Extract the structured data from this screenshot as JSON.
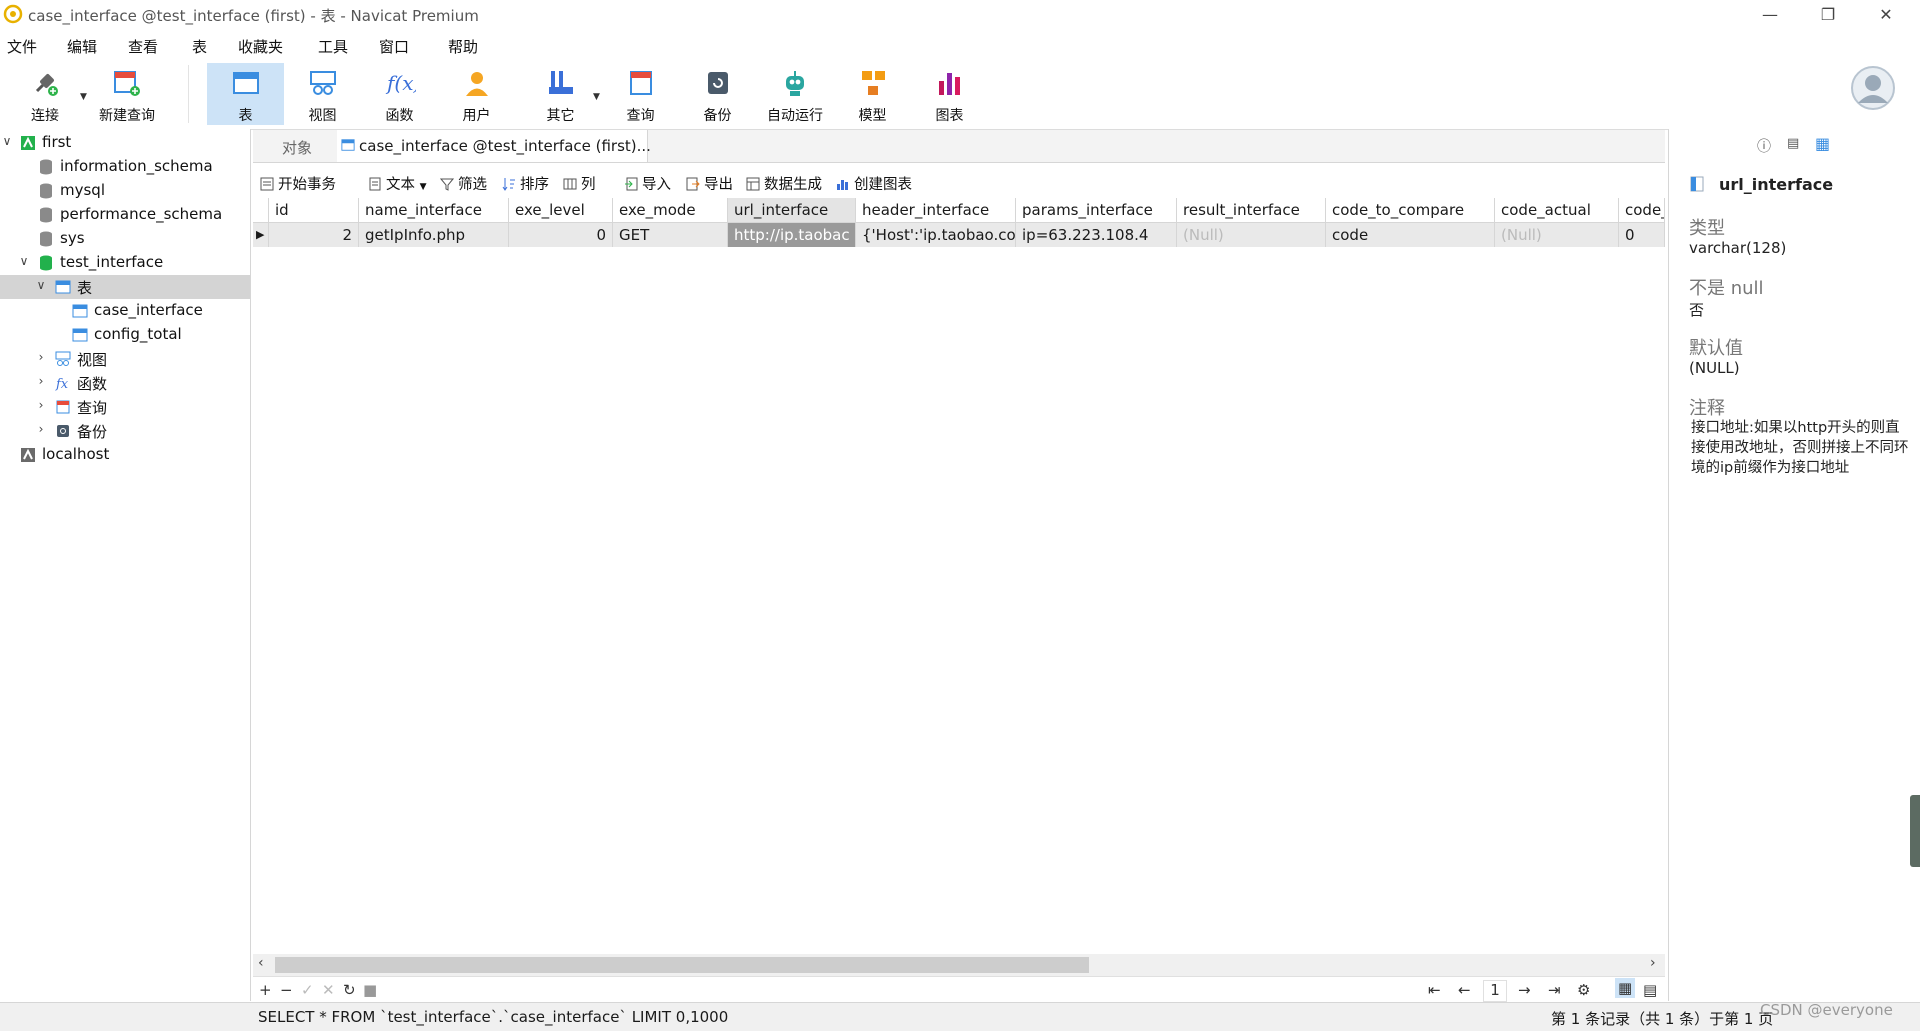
{
  "window": {
    "title": "case_interface @test_interface (first) - 表 - Navicat Premium"
  },
  "menu": [
    "文件",
    "编辑",
    "查看",
    "表",
    "收藏夹",
    "工具",
    "窗口",
    "帮助"
  ],
  "toolbar": {
    "connect": "连接",
    "new_query": "新建查询",
    "table": "表",
    "view": "视图",
    "function": "函数",
    "user": "用户",
    "other": "其它",
    "query": "查询",
    "backup": "备份",
    "automation": "自动运行",
    "model": "模型",
    "chart": "图表"
  },
  "tree": {
    "first": "first",
    "db1": "information_schema",
    "db2": "mysql",
    "db3": "performance_schema",
    "db4": "sys",
    "db5": "test_interface",
    "tables": "表",
    "t1": "case_interface",
    "t2": "config_total",
    "views": "视图",
    "functions": "函数",
    "queries": "查询",
    "backups": "备份",
    "localhost": "localhost"
  },
  "tabs": {
    "objects": "对象",
    "active": "case_interface @test_interface (first)..."
  },
  "actions": {
    "begin": "开始事务",
    "text": "文本",
    "filter": "筛选",
    "sort": "排序",
    "columns": "列",
    "import": "导入",
    "export": "导出",
    "datagen": "数据生成",
    "createchart": "创建图表"
  },
  "grid": {
    "columns": [
      "id",
      "name_interface",
      "exe_level",
      "exe_mode",
      "url_interface",
      "header_interface",
      "params_interface",
      "result_interface",
      "code_to_compare",
      "code_actual",
      "code_("
    ],
    "row": [
      "2",
      "getIpInfo.php",
      "0",
      "GET",
      "http://ip.taobac",
      "{'Host':'ip.taobao.co",
      "ip=63.223.108.4",
      "(Null)",
      "code",
      "(Null)",
      "0"
    ]
  },
  "bottom": {
    "page": "1"
  },
  "status": {
    "sql": "SELECT * FROM `test_interface`.`case_interface` LIMIT 0,1000",
    "records": "第 1 条记录（共 1 条）于第 1 页",
    "watermark": "CSDN @everyone"
  },
  "rightpanel": {
    "field": "url_interface",
    "type_label": "类型",
    "type_value": "varchar(128)",
    "notnull_label": "不是 null",
    "notnull_value": "否",
    "default_label": "默认值",
    "default_value": "(NULL)",
    "comment_label": "注释",
    "comment_value": "接口地址:如果以http开头的则直接使用改地址，否则拼接上不同环境的ip前缀作为接口地址"
  },
  "colors": {
    "selected_tool": "#cde3f7",
    "db_green": "#22b14c",
    "table_blue": "#3a8de0"
  }
}
